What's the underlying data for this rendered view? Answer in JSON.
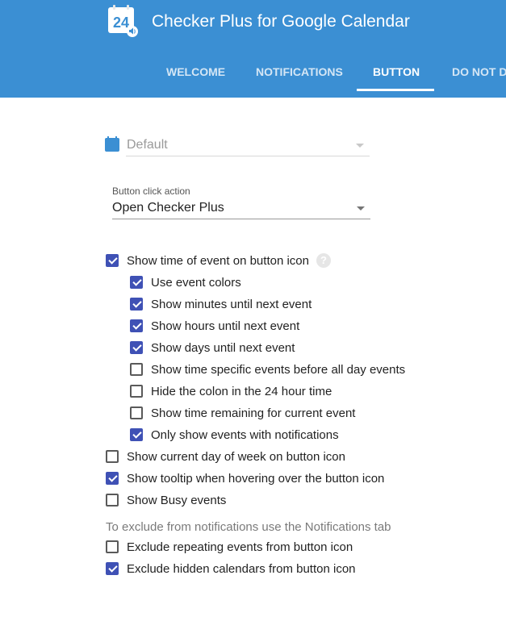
{
  "app": {
    "title": "Checker Plus for Google Calendar",
    "logo_number": "24",
    "accent_color": "#3b8fd3",
    "checkbox_color": "#3f51b5"
  },
  "tabs": [
    {
      "label": "WELCOME",
      "active": false
    },
    {
      "label": "NOTIFICATIONS",
      "active": false
    },
    {
      "label": "BUTTON",
      "active": true
    },
    {
      "label": "DO NOT DI",
      "active": false
    }
  ],
  "icon_dropdown": {
    "value": "Default",
    "disabled": true
  },
  "click_action": {
    "label": "Button click action",
    "value": "Open Checker Plus"
  },
  "options": [
    {
      "label": "Show time of event on button icon",
      "checked": true,
      "has_help": true
    },
    {
      "label": "Use event colors",
      "checked": true
    },
    {
      "label": "Show minutes until next event",
      "checked": true
    },
    {
      "label": "Show hours until next event",
      "checked": true
    },
    {
      "label": "Show days until next event",
      "checked": true
    },
    {
      "label": "Show time specific events before all day events",
      "checked": false
    },
    {
      "label": "Hide the colon in the 24 hour time",
      "checked": false
    },
    {
      "label": "Show time remaining for current event",
      "checked": false
    },
    {
      "label": "Only show events with notifications",
      "checked": true
    },
    {
      "label": "Show current day of week on button icon",
      "checked": false
    },
    {
      "label": "Show tooltip when hovering over the button icon",
      "checked": true
    },
    {
      "label": "Show Busy events",
      "checked": false
    }
  ],
  "exclude_note": "To exclude from notifications use the Notifications tab",
  "exclude_options": [
    {
      "label": "Exclude repeating events from button icon",
      "checked": false
    },
    {
      "label": "Exclude hidden calendars from button icon",
      "checked": true
    }
  ],
  "help_icon_symbol": "?"
}
